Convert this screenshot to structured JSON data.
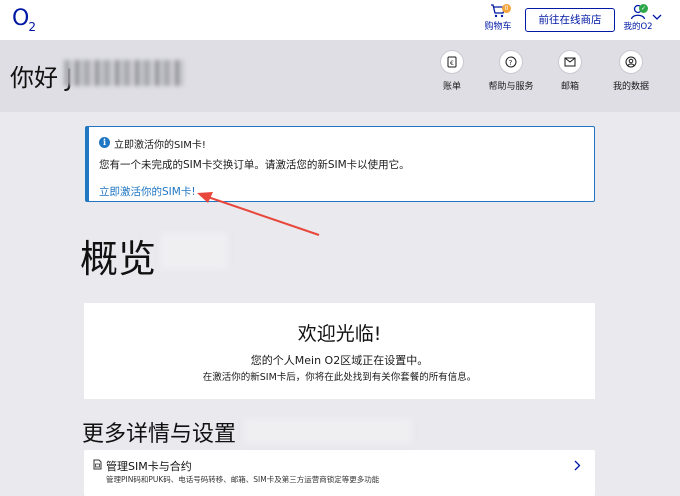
{
  "header": {
    "logo_main": "O",
    "logo_sub": "2",
    "cart_label": "购物车",
    "cart_badge": "0",
    "shop_button": "前往在线商店",
    "my_o2_label": "我的O2",
    "my_o2_badge": "✓",
    "icons": {
      "cart": "cart-icon",
      "user": "user-icon",
      "chevron": "chevron-down-icon"
    }
  },
  "greeting": {
    "title": "你好 J",
    "nav": [
      {
        "label": "账单",
        "icon": "bill-icon"
      },
      {
        "label": "帮助与服务",
        "icon": "help-icon"
      },
      {
        "label": "邮箱",
        "icon": "mail-icon"
      },
      {
        "label": "我的数据",
        "icon": "data-icon"
      }
    ]
  },
  "alert": {
    "info": "i",
    "title": "立即激活你的SIM卡!",
    "body": "您有一个未完成的SIM卡交换订单。请激活您的新SIM卡以使用它。",
    "link": "立即激活你的SIM卡!"
  },
  "overview": {
    "title": "概览"
  },
  "welcome": {
    "title": "欢迎光临!",
    "line1": "您的个人Mein O2区域正在设置中。",
    "line2": "在激活你的新SIM卡后，你将在此处找到有关你套餐的所有信息。"
  },
  "more": {
    "title": "更多详情与设置"
  },
  "sim": {
    "title": "管理SIM卡与合约",
    "subtitle": "管理PIN码和PUK码、电话号码转移、邮箱、SIM卡及第三方运营商锁定等更多功能",
    "icons": {
      "sim": "sim-card-icon",
      "chevron": "chevron-right-icon"
    }
  },
  "colors": {
    "brand": "#0019a5",
    "info": "#1f76c2",
    "annotation": "#e8473c",
    "success": "#2ea84a",
    "badge": "#f3a43b"
  }
}
